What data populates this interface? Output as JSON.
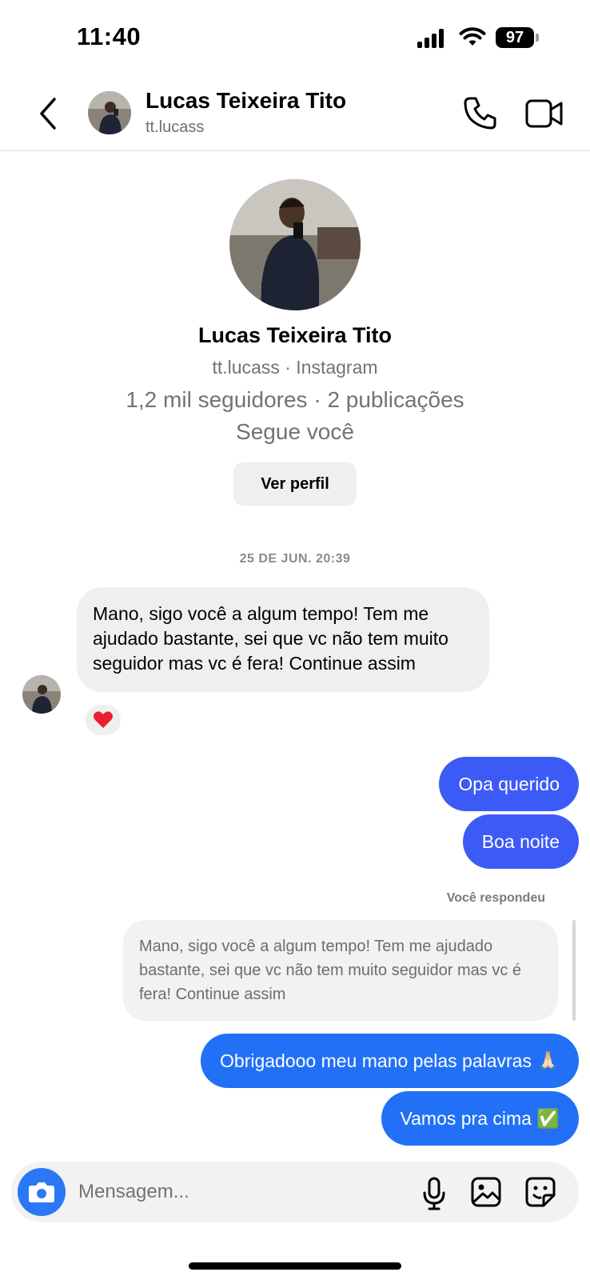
{
  "status_bar": {
    "time": "11:40",
    "battery": "97"
  },
  "header": {
    "name": "Lucas Teixeira Tito",
    "username": "tt.lucass"
  },
  "profile": {
    "name": "Lucas Teixeira Tito",
    "handle": "tt.lucass · Instagram",
    "stats": "1,2 mil seguidores · 2 publicações",
    "follows_you": "Segue você",
    "view_profile_label": "Ver perfil"
  },
  "conversation": {
    "date_separator": "25 DE JUN. 20:39",
    "incoming_message": "Mano, sigo você a algum tempo! Tem me ajudado bastante, sei que vc não tem muito seguidor mas vc é fera! Continue assim",
    "reaction": "❤️",
    "outgoing_1": "Opa querido",
    "outgoing_2": "Boa noite",
    "replied_label": "Você respondeu",
    "replied_quote": "Mano, sigo você a algum tempo! Tem me ajudado bastante, sei que vc não tem muito seguidor mas vc é fera! Continue assim",
    "outgoing_3": "Obrigadooo meu mano pelas palavras 🙏🏻",
    "outgoing_4": "Vamos pra cima ✅"
  },
  "composer": {
    "placeholder": "Mensagem..."
  },
  "icons": {
    "back": "chevron-left-icon",
    "call": "phone-icon",
    "video": "video-camera-icon",
    "camera": "camera-icon",
    "mic": "microphone-icon",
    "gallery": "image-icon",
    "sticker": "sticker-icon"
  },
  "colors": {
    "outgoing_bubble": "#3c5bf6",
    "outgoing_bubble_alt": "#2270f6",
    "incoming_bubble": "#efefef",
    "camera_button": "#2b78f6"
  }
}
